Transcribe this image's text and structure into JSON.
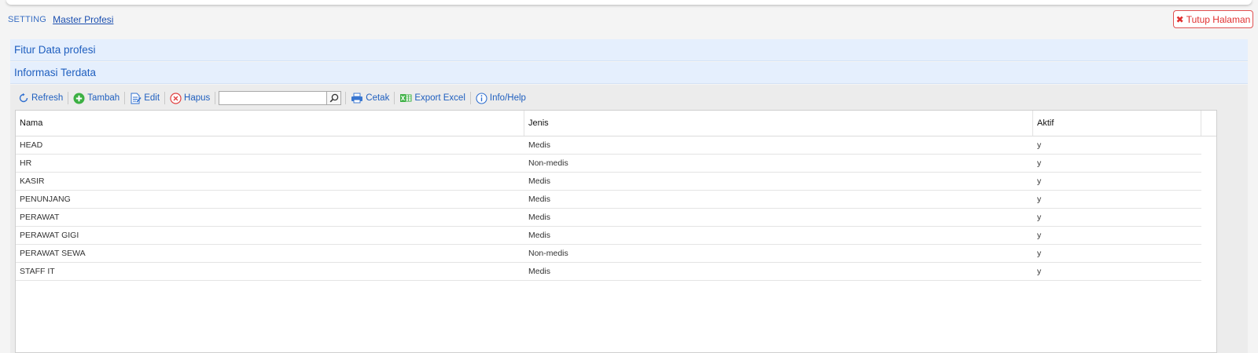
{
  "breadcrumb": {
    "root": "SETTING",
    "current": "Master Profesi"
  },
  "close_button": {
    "label": "Tutup Halaman"
  },
  "panels": [
    {
      "title": "Fitur Data profesi"
    },
    {
      "title": "Informasi Terdata"
    }
  ],
  "toolbar": {
    "refresh": "Refresh",
    "add": "Tambah",
    "edit": "Edit",
    "delete": "Hapus",
    "search_value": "",
    "print": "Cetak",
    "export": "Export Excel",
    "help": "Info/Help"
  },
  "table": {
    "columns": [
      "Nama",
      "Jenis",
      "Aktif"
    ],
    "rows": [
      [
        "HEAD",
        "Medis",
        "y"
      ],
      [
        "HR",
        "Non-medis",
        "y"
      ],
      [
        "KASIR",
        "Medis",
        "y"
      ],
      [
        "PENUNJANG",
        "Medis",
        "y"
      ],
      [
        "PERAWAT",
        "Medis",
        "y"
      ],
      [
        "PERAWAT GIGI",
        "Medis",
        "y"
      ],
      [
        "PERAWAT SEWA",
        "Non-medis",
        "y"
      ],
      [
        "STAFF IT",
        "Medis",
        "y"
      ]
    ]
  },
  "colors": {
    "accent": "#1f5fbf",
    "panel_bg": "#e5effd",
    "close_red": "#e03030",
    "add_green": "#3cb043",
    "delete_red": "#e04040"
  },
  "icons": {
    "refresh": "refresh-icon",
    "add": "plus-circle-icon",
    "edit": "edit-document-icon",
    "delete": "x-circle-icon",
    "search": "magnifier-icon",
    "print": "printer-icon",
    "export": "excel-icon",
    "help": "info-icon",
    "close": "close-x-icon"
  }
}
